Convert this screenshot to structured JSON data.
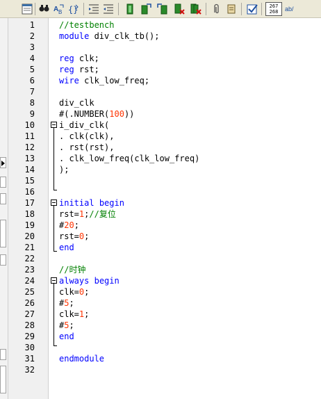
{
  "toolbar": {
    "icons": [
      "editor-window-icon",
      "find-icon",
      "find-replace-icon",
      "bracket-match-icon",
      "indent-icon",
      "outdent-icon",
      "bookmark-icon",
      "bookmark-next-icon",
      "bookmark-prev-icon",
      "bookmark-clear-icon",
      "bookmark-clear-all-icon",
      "attach-icon",
      "scroll-icon",
      "checkbox-icon",
      "line-column-icon",
      "spell-check-icon"
    ],
    "line_column_badge_top": "267",
    "line_column_badge_bottom": "268",
    "spell_label": "ab/"
  },
  "colors": {
    "keyword": "#0000ff",
    "comment": "#008000",
    "number": "#ff3300",
    "text": "#000000"
  },
  "editor": {
    "lines": [
      {
        "n": "1",
        "t": "//testbench"
      },
      {
        "n": "2",
        "t": "module div_clk_tb();"
      },
      {
        "n": "3",
        "t": ""
      },
      {
        "n": "4",
        "t": "reg clk;"
      },
      {
        "n": "5",
        "t": "reg rst;"
      },
      {
        "n": "6",
        "t": "wire clk_low_freq;"
      },
      {
        "n": "7",
        "t": ""
      },
      {
        "n": "8",
        "t": "div_clk"
      },
      {
        "n": "9",
        "t": "#(.NUMBER(100))"
      },
      {
        "n": "10",
        "t": "i_div_clk("
      },
      {
        "n": "11",
        "t": ". clk(clk),"
      },
      {
        "n": "12",
        "t": ". rst(rst),"
      },
      {
        "n": "13",
        "t": ". clk_low_freq(clk_low_freq)"
      },
      {
        "n": "14",
        "t": ");"
      },
      {
        "n": "15",
        "t": ""
      },
      {
        "n": "16",
        "t": ""
      },
      {
        "n": "17",
        "t": "initial begin"
      },
      {
        "n": "18",
        "t": "rst=1;//复位"
      },
      {
        "n": "19",
        "t": "#20;"
      },
      {
        "n": "20",
        "t": "rst=0;"
      },
      {
        "n": "21",
        "t": "end"
      },
      {
        "n": "22",
        "t": ""
      },
      {
        "n": "23",
        "t": "//时钟"
      },
      {
        "n": "24",
        "t": "always begin"
      },
      {
        "n": "25",
        "t": "clk=0;"
      },
      {
        "n": "26",
        "t": "#5;"
      },
      {
        "n": "27",
        "t": "clk=1;"
      },
      {
        "n": "28",
        "t": "#5;"
      },
      {
        "n": "29",
        "t": "end"
      },
      {
        "n": "30",
        "t": ""
      },
      {
        "n": "31",
        "t": "endmodule"
      },
      {
        "n": "32",
        "t": ""
      }
    ]
  }
}
